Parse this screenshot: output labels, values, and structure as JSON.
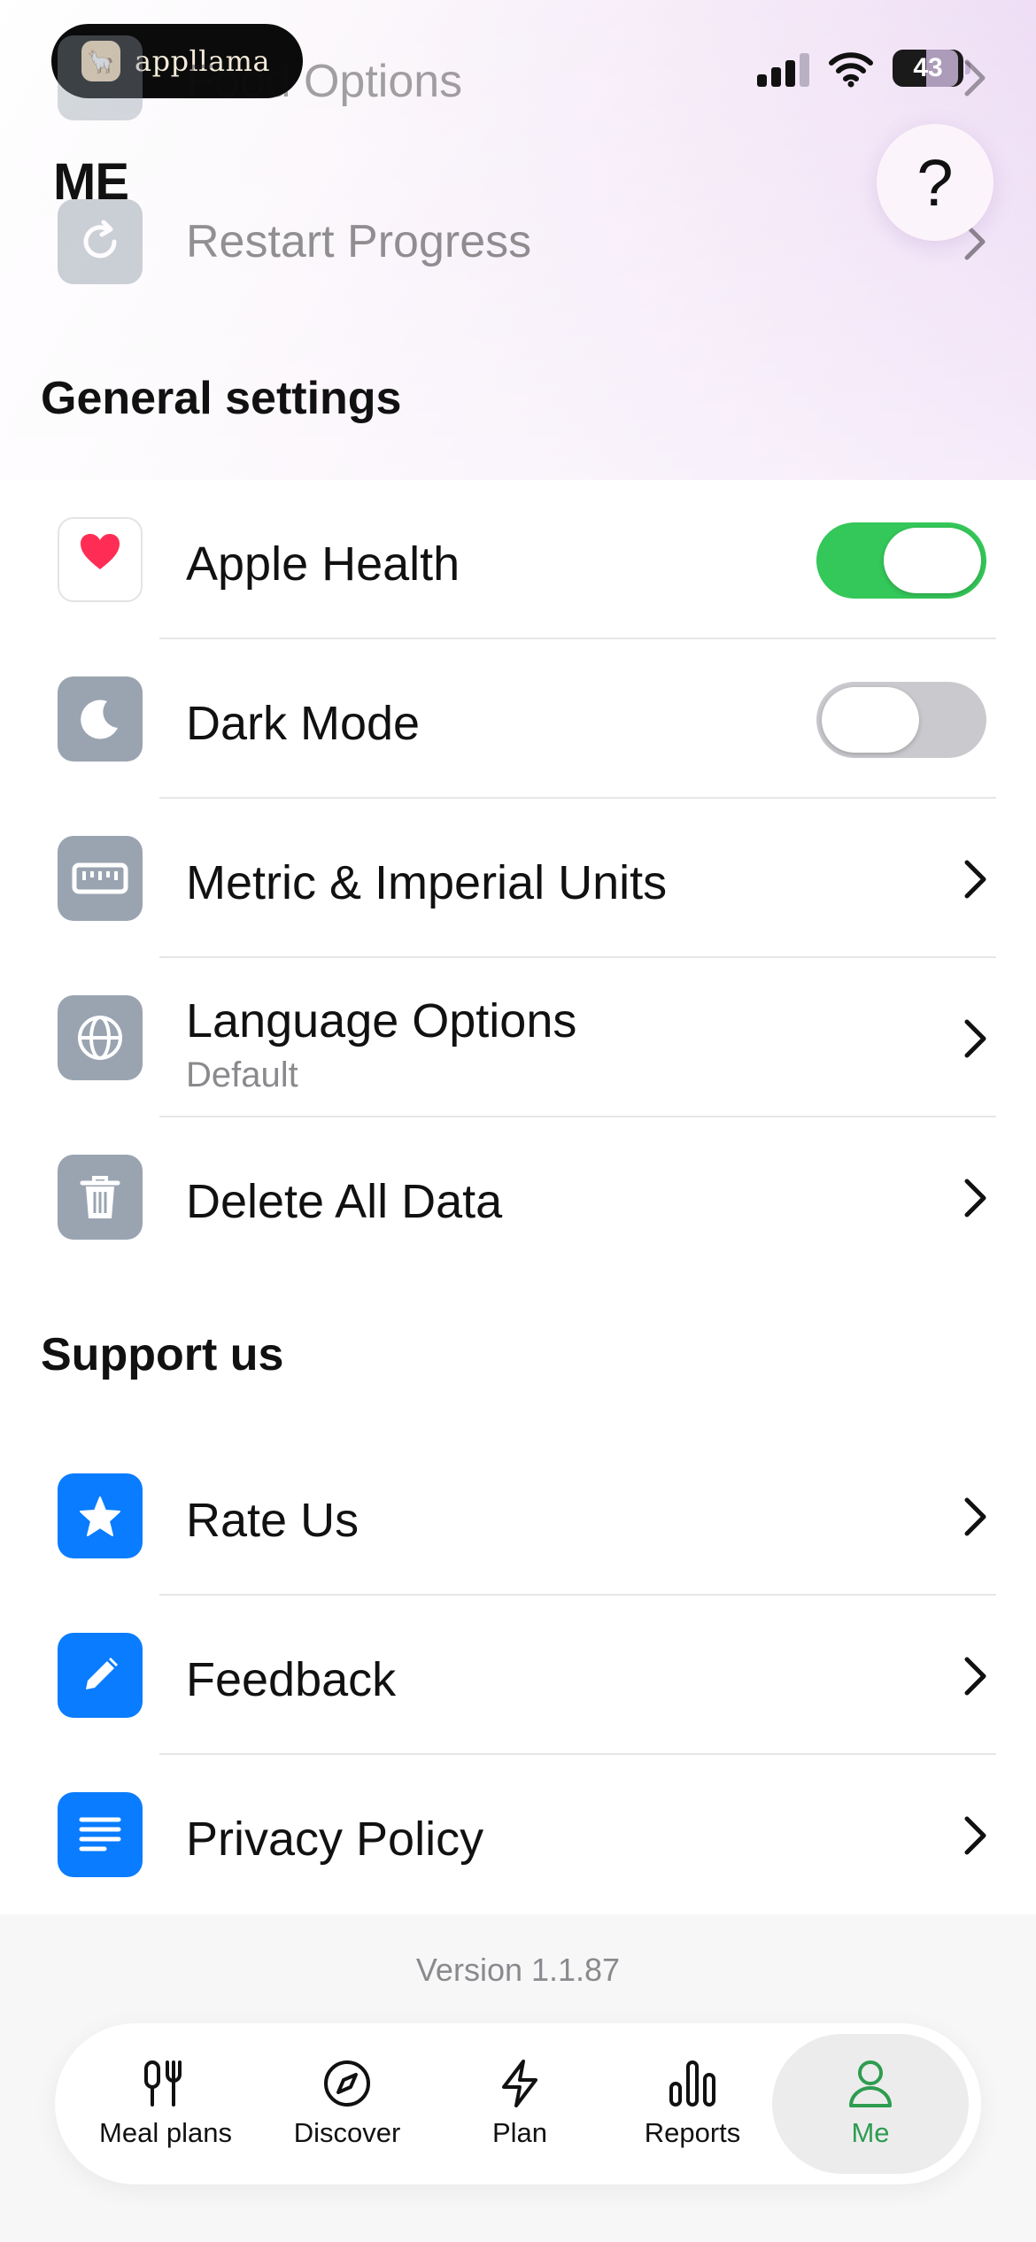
{
  "status_bar": {
    "app_name": "appllama",
    "battery": "43"
  },
  "header": {
    "title": "ME",
    "help_symbol": "?"
  },
  "ghost_rows": [
    {
      "label": "Food Options"
    },
    {
      "label": "Restart Progress"
    }
  ],
  "general": {
    "title": "General settings",
    "items": [
      {
        "label": "Apple Health",
        "icon": "heart-icon",
        "toggle": true
      },
      {
        "label": "Dark Mode",
        "icon": "moon-icon",
        "toggle": false
      },
      {
        "label": "Metric & Imperial Units",
        "icon": "ruler-icon"
      },
      {
        "label": "Language Options",
        "sublabel": "Default",
        "icon": "globe-icon"
      },
      {
        "label": "Delete All Data",
        "icon": "trash-icon"
      }
    ]
  },
  "support": {
    "title": "Support us",
    "items": [
      {
        "label": "Rate Us",
        "icon": "star-icon"
      },
      {
        "label": "Feedback",
        "icon": "pencil-icon"
      },
      {
        "label": "Privacy Policy",
        "icon": "document-icon"
      }
    ]
  },
  "version": "Version 1.1.87",
  "tabs": [
    {
      "label": "Meal plans",
      "icon": "meal-plans-icon"
    },
    {
      "label": "Discover",
      "icon": "compass-icon"
    },
    {
      "label": "Plan",
      "icon": "lightning-icon"
    },
    {
      "label": "Reports",
      "icon": "bar-chart-icon"
    },
    {
      "label": "Me",
      "icon": "person-icon",
      "active": true
    }
  ],
  "colors": {
    "toggle_on": "#34c759",
    "accent_blue": "#0a7cff",
    "active_tab": "#2e9c4f"
  }
}
